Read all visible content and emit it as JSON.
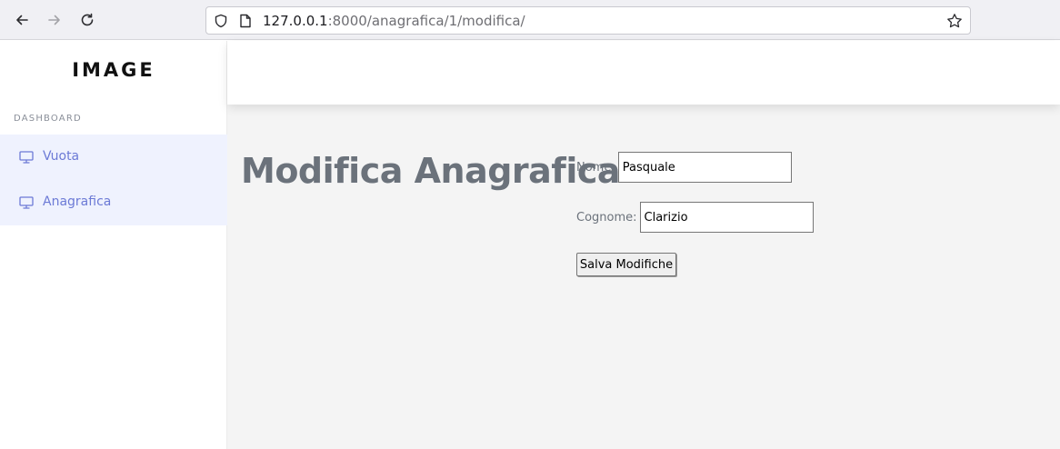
{
  "browser": {
    "url_host": "127.0.0.1",
    "url_rest": ":8000/anagrafica/1/modifica/"
  },
  "sidebar": {
    "logo": "IMAGE",
    "section_label": "DASHBOARD",
    "items": [
      {
        "label": "Vuota",
        "icon": "monitor-icon"
      },
      {
        "label": "Anagrafica",
        "icon": "monitor-icon"
      }
    ]
  },
  "main": {
    "title": "Modifica Anagrafica",
    "form": {
      "nome_label": "Nome:",
      "nome_value": "Pasquale",
      "cognome_label": "Cognome:",
      "cognome_value": "Clarizio",
      "submit_label": "Salva Modifiche"
    }
  },
  "colors": {
    "accent": "#6c7ad6",
    "menu_bg": "#eff2fe",
    "content_bg": "#f4f4f4",
    "title": "#6b727b"
  }
}
